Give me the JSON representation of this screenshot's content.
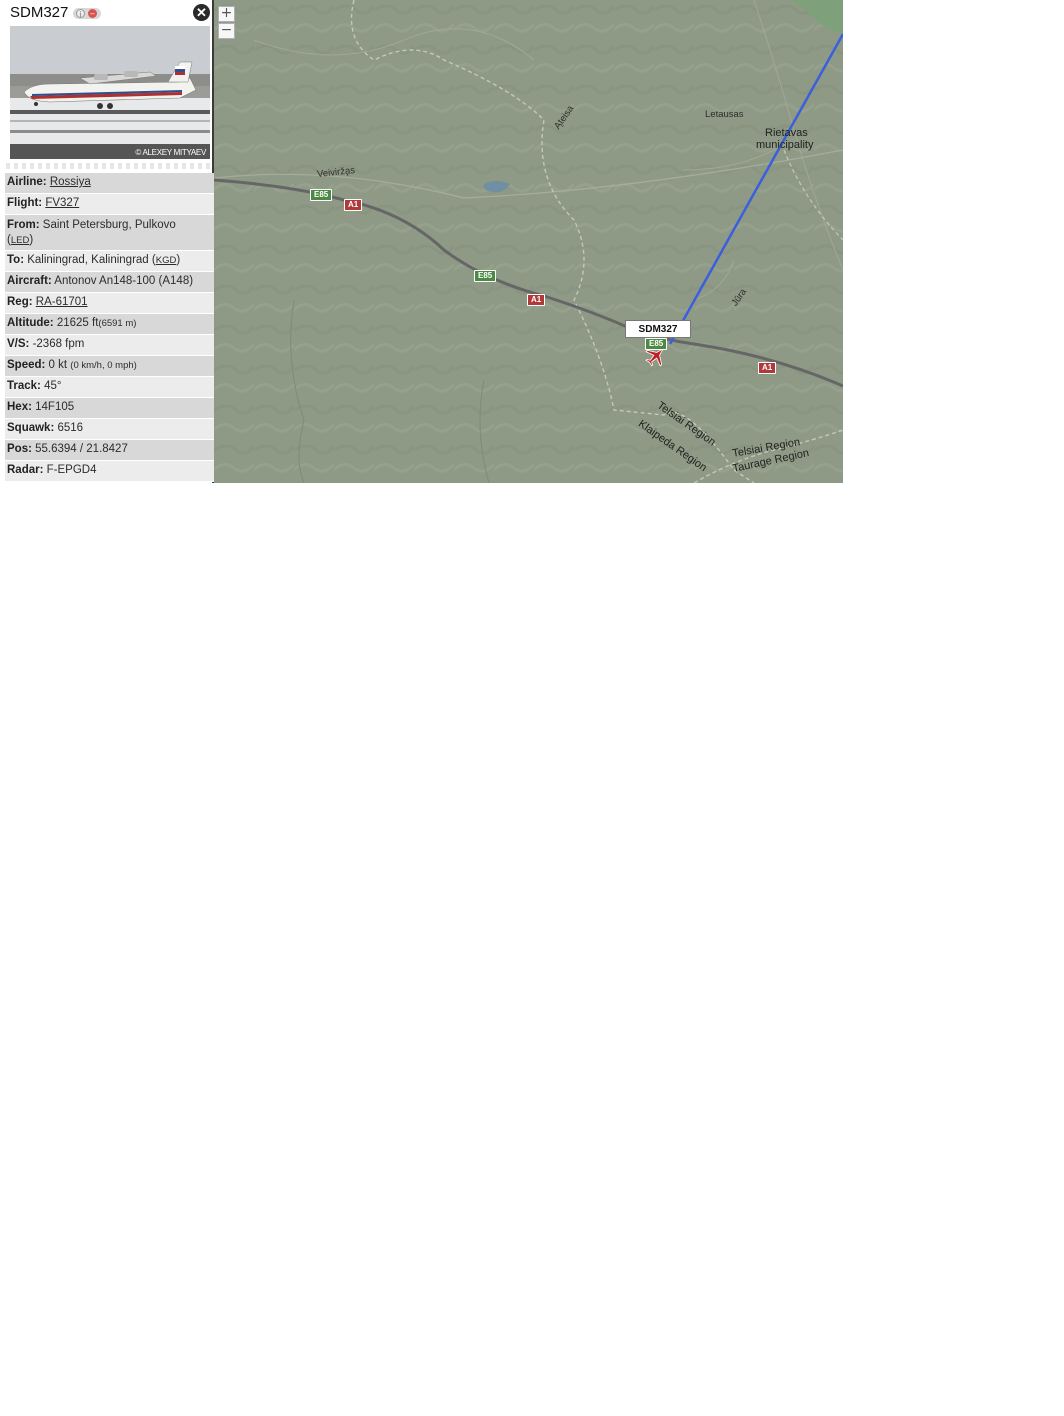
{
  "panel": {
    "callsign": "SDM327",
    "photo_credit": "© ALEXEY MITYAEV",
    "rows": {
      "airline": {
        "label": "Airline:",
        "value": "Rossiya"
      },
      "flight": {
        "label": "Flight:",
        "value": "FV327"
      },
      "from": {
        "label": "From:",
        "value": "Saint Petersburg, Pulkovo",
        "code": "LED"
      },
      "to": {
        "label": "To:",
        "value": "Kaliningrad, Kaliningrad",
        "code": "KGD"
      },
      "aircraft": {
        "label": "Aircraft:",
        "value": "Antonov An148-100 (A148)"
      },
      "reg": {
        "label": "Reg:",
        "value": "RA-61701"
      },
      "altitude": {
        "label": "Altitude:",
        "value": "21625 ft",
        "secondary": "(6591 m)"
      },
      "vs": {
        "label": "V/S:",
        "value": "-2368 fpm"
      },
      "speed": {
        "label": "Speed:",
        "value": "0 kt",
        "secondary": "(0 km/h, 0 mph)"
      },
      "track": {
        "label": "Track:",
        "value": "45°"
      },
      "hex": {
        "label": "Hex:",
        "value": "14F105"
      },
      "squawk": {
        "label": "Squawk:",
        "value": "6516"
      },
      "pos": {
        "label": "Pos:",
        "value": "55.6394 / 21.8427"
      },
      "radar": {
        "label": "Radar:",
        "value": "F-EPGD4"
      }
    }
  },
  "map": {
    "zoom_in": "+",
    "zoom_out": "−",
    "aircraft_label": "SDM327",
    "places": {
      "letausas": "Letausas",
      "rietavas": "Rietavas",
      "municipality": "municipality",
      "veivirzas": "Veivirža̧s",
      "ateisa": "Ąteisa",
      "jura": "Jūra",
      "telsiai": "Telsiai Region",
      "klaipeda": "Klaipeda Region",
      "telsiai2": "Telsiai Region",
      "taurage": "Taurage Region"
    },
    "shields": {
      "e85_a": "E85",
      "a1_a": "A1",
      "e85_b": "E85",
      "a1_b": "A1",
      "e85_c": "E85",
      "a1_c": "A1"
    },
    "colors": {
      "terrain": "#8e9a85",
      "road": "#666666",
      "flight_path": "#3b5fdd",
      "aircraft": "#c0202a"
    }
  }
}
